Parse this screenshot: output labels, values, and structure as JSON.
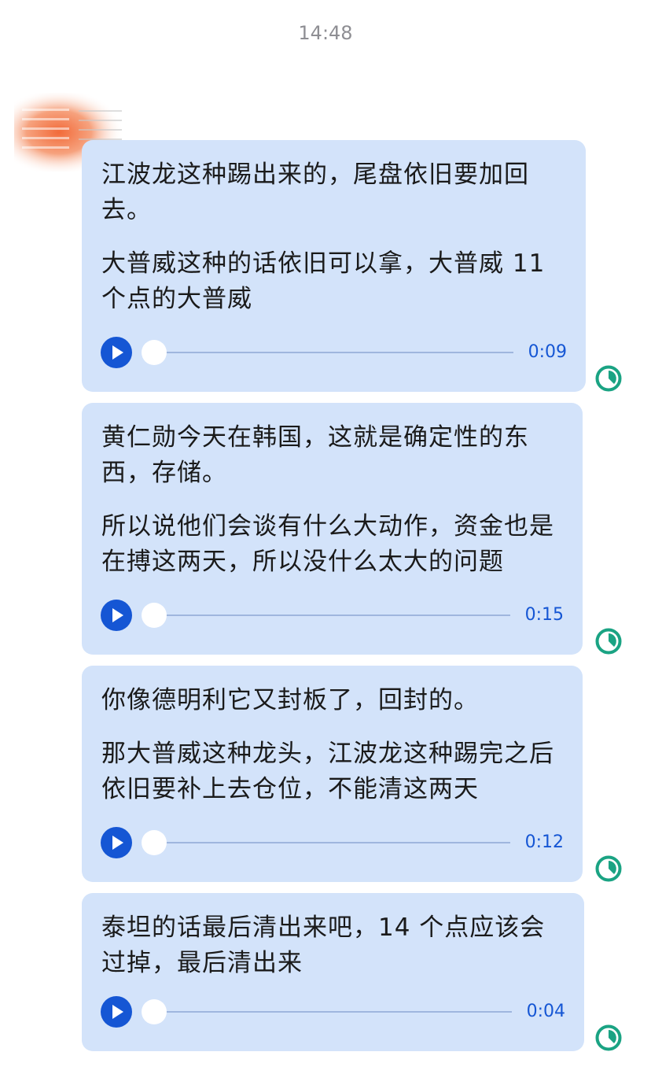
{
  "header": {
    "time": "14:48"
  },
  "messages": [
    {
      "paragraphs": [
        "江波龙这种踢出来的，尾盘依旧要加回去。",
        "大普威这种的话依旧可以拿，大普威 11 个点的大普威"
      ],
      "duration": "0:09"
    },
    {
      "paragraphs": [
        "黄仁勋今天在韩国，这就是确定性的东西，存储。",
        "所以说他们会谈有什么大动作，资金也是在搏这两天，所以没什么太大的问题"
      ],
      "duration": "0:15"
    },
    {
      "paragraphs": [
        "你像德明利它又封板了，回封的。",
        "那大普威这种龙头，江波龙这种踢完之后依旧要补上去仓位，不能清这两天"
      ],
      "duration": "0:12"
    },
    {
      "paragraphs": [
        "泰坦的话最后清出来吧，14 个点应该会过掉，最后清出来"
      ],
      "duration": "0:04"
    }
  ],
  "icons": {
    "play": "play-icon",
    "status": "clock-status-icon",
    "avatar": "avatar-pixelated"
  },
  "colors": {
    "bubble": "#d3e3fa",
    "accent": "#1556d4",
    "status": "#1aa383",
    "timestamp": "#8e8e93"
  }
}
